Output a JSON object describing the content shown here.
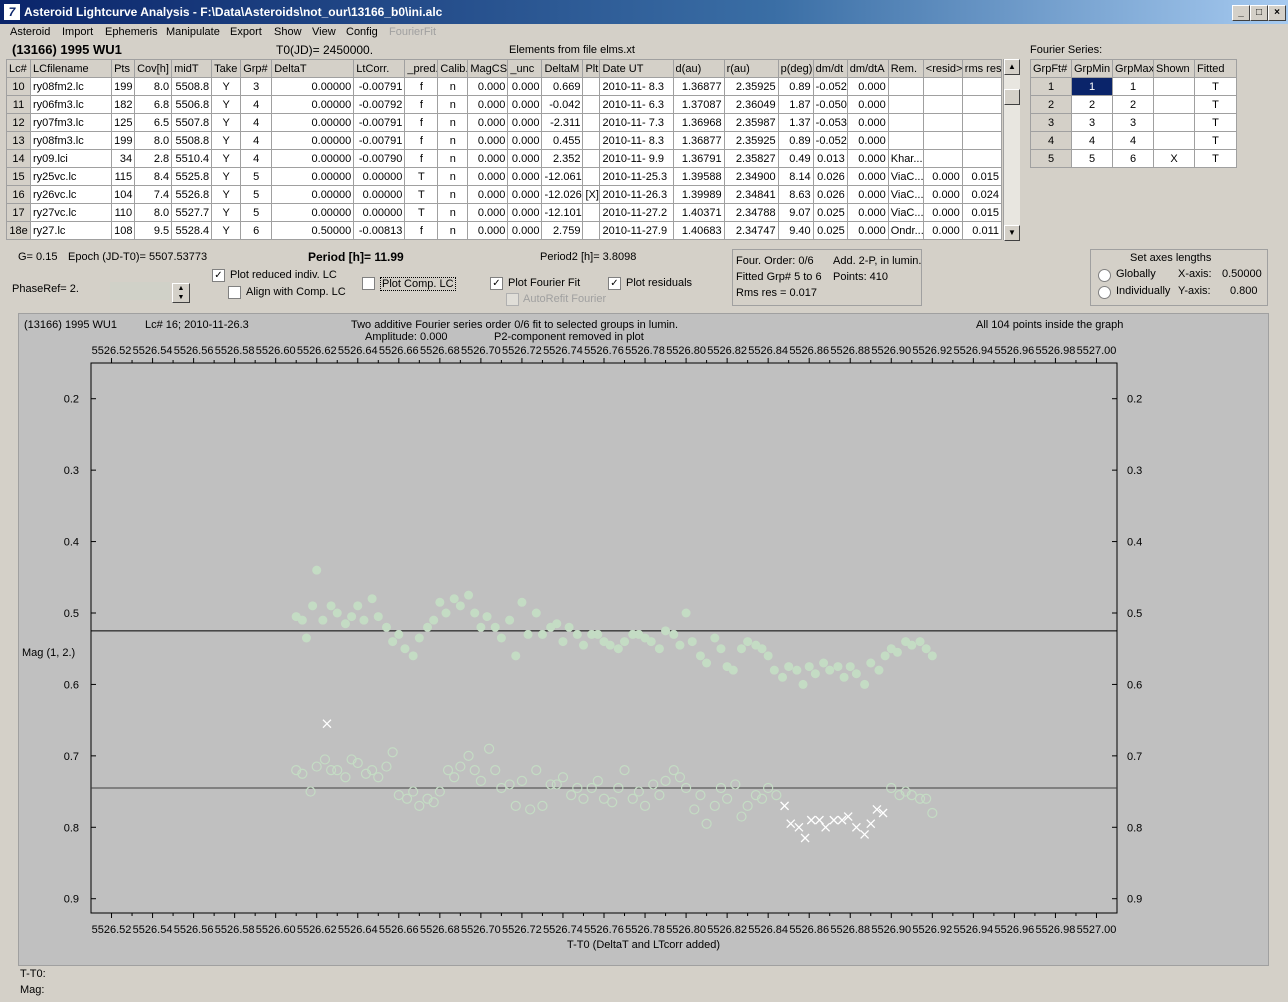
{
  "window": {
    "title": "Asteroid Lightcurve Analysis - F:\\Data\\Asteroids\\not_our\\13166_b0\\ini.alc",
    "icon": "app-icon"
  },
  "menu": [
    "Asteroid",
    "Import",
    "Ephemeris",
    "Manipulate",
    "Export",
    "Show",
    "View",
    "Config",
    "FourierFit"
  ],
  "header": {
    "asteroid": "(13166) 1995 WU1",
    "t0": "T0(JD)= 2450000.",
    "elements": "Elements from file elms.xt",
    "fourier_title": "Fourier Series:"
  },
  "lc_table": {
    "columns": [
      "Lc#",
      "LCfilename",
      "Pts",
      "Cov[h]",
      "midT",
      "Take",
      "Grp#",
      "DeltaT",
      "LtCorr.",
      "_pred.",
      "Calib.",
      "MagCS",
      "_unc",
      "DeltaM",
      "Plt",
      "Date UT",
      "d(au)",
      "r(au)",
      "p(deg)",
      "dm/dt",
      "dm/dtA",
      "Rem.",
      "<resid>",
      "rms res"
    ],
    "rows": [
      [
        "10",
        "ry08fm2.lc",
        "199",
        "8.0",
        "5508.8",
        "Y",
        "3",
        "0.00000",
        "-0.00791",
        "f",
        "n",
        "0.000",
        "0.000",
        "0.669",
        "",
        "2010-11- 8.3",
        "1.36877",
        "2.35925",
        "0.89",
        "-0.052",
        "0.000",
        "",
        "",
        ""
      ],
      [
        "11",
        "ry06fm3.lc",
        "182",
        "6.8",
        "5506.8",
        "Y",
        "4",
        "0.00000",
        "-0.00792",
        "f",
        "n",
        "0.000",
        "0.000",
        "-0.042",
        "",
        "2010-11- 6.3",
        "1.37087",
        "2.36049",
        "1.87",
        "-0.050",
        "0.000",
        "",
        "",
        ""
      ],
      [
        "12",
        "ry07fm3.lc",
        "125",
        "6.5",
        "5507.8",
        "Y",
        "4",
        "0.00000",
        "-0.00791",
        "f",
        "n",
        "0.000",
        "0.000",
        "-2.311",
        "",
        "2010-11- 7.3",
        "1.36968",
        "2.35987",
        "1.37",
        "-0.053",
        "0.000",
        "",
        "",
        ""
      ],
      [
        "13",
        "ry08fm3.lc",
        "199",
        "8.0",
        "5508.8",
        "Y",
        "4",
        "0.00000",
        "-0.00791",
        "f",
        "n",
        "0.000",
        "0.000",
        "0.455",
        "",
        "2010-11- 8.3",
        "1.36877",
        "2.35925",
        "0.89",
        "-0.052",
        "0.000",
        "",
        "",
        ""
      ],
      [
        "14",
        "ry09.lci",
        "34",
        "2.8",
        "5510.4",
        "Y",
        "4",
        "0.00000",
        "-0.00790",
        "f",
        "n",
        "0.000",
        "0.000",
        "2.352",
        "",
        "2010-11- 9.9",
        "1.36791",
        "2.35827",
        "0.49",
        "0.013",
        "0.000",
        "Khar...",
        "",
        ""
      ],
      [
        "15",
        "ry25vc.lc",
        "115",
        "8.4",
        "5525.8",
        "Y",
        "5",
        "0.00000",
        "0.00000",
        "T",
        "n",
        "0.000",
        "0.000",
        "-12.061",
        "",
        "2010-11-25.3",
        "1.39588",
        "2.34900",
        "8.14",
        "0.026",
        "0.000",
        "ViaC...",
        "0.000",
        "0.015"
      ],
      [
        "16",
        "ry26vc.lc",
        "104",
        "7.4",
        "5526.8",
        "Y",
        "5",
        "0.00000",
        "0.00000",
        "T",
        "n",
        "0.000",
        "0.000",
        "-12.026",
        "[X]",
        "2010-11-26.3",
        "1.39989",
        "2.34841",
        "8.63",
        "0.026",
        "0.000",
        "ViaC...",
        "0.000",
        "0.024"
      ],
      [
        "17",
        "ry27vc.lc",
        "110",
        "8.0",
        "5527.7",
        "Y",
        "5",
        "0.00000",
        "0.00000",
        "T",
        "n",
        "0.000",
        "0.000",
        "-12.101",
        "",
        "2010-11-27.2",
        "1.40371",
        "2.34788",
        "9.07",
        "0.025",
        "0.000",
        "ViaC...",
        "0.000",
        "0.015"
      ],
      [
        "18e",
        "ry27.lc",
        "108",
        "9.5",
        "5528.4",
        "Y",
        "6",
        "0.50000",
        "-0.00813",
        "f",
        "n",
        "0.000",
        "0.000",
        "2.759",
        "",
        "2010-11-27.9",
        "1.40683",
        "2.34747",
        "9.40",
        "0.025",
        "0.000",
        "Ondr...",
        "0.000",
        "0.011"
      ]
    ]
  },
  "fourier_table": {
    "columns": [
      "GrpFt#",
      "GrpMin",
      "GrpMax",
      "Shown",
      "Fitted"
    ],
    "rows": [
      [
        "1",
        "1",
        "1",
        "",
        "T"
      ],
      [
        "2",
        "2",
        "2",
        "",
        "T"
      ],
      [
        "3",
        "3",
        "3",
        "",
        "T"
      ],
      [
        "4",
        "4",
        "4",
        "",
        "T"
      ],
      [
        "5",
        "5",
        "6",
        "X",
        "T"
      ]
    ]
  },
  "params": {
    "g": "G= 0.15",
    "epoch": "Epoch (JD-T0)= 5507.53773",
    "period": "Period [h]= 11.99",
    "period2": "Period2 [h]= 3.8098",
    "phaseref": "PhaseRef= 2."
  },
  "checks": {
    "plot_reduced": {
      "label": "Plot reduced indiv. LC",
      "checked": "✓"
    },
    "align_comp": {
      "label": "Align with Comp. LC",
      "checked": ""
    },
    "plot_comp": {
      "label": "Plot Comp. LC",
      "checked": ""
    },
    "plot_fourier": {
      "label": "Plot Fourier Fit",
      "checked": "✓"
    },
    "autorefit": {
      "label": "AutoRefit Fourier",
      "checked": ""
    },
    "plot_resid": {
      "label": "Plot residuals",
      "checked": "✓"
    }
  },
  "fitinfo": {
    "line1a": "Four. Order:  0/6",
    "line1b": "Add. 2-P, in lumin.",
    "line2a": "Fitted Grp# 5 to 6",
    "line2b": "Points: 410",
    "line3": "Rms res     = 0.017"
  },
  "axes_box": {
    "title": "Set axes lengths",
    "globally": "Globally",
    "individually": "Individually",
    "xaxis": "X-axis:",
    "xval": "0.50000",
    "yaxis": "Y-axis:",
    "yval": "0.800"
  },
  "plot_header": {
    "obj": "(13166) 1995 WU1",
    "lc": "Lc# 16; 2010-11-26.3",
    "desc1": "Two additive Fourier series order 0/6 fit to selected groups in lumin.",
    "desc2": "Amplitude: 0.000",
    "desc3": "P2-component removed in plot",
    "inside": "All 104 points inside the graph"
  },
  "plot_status": {
    "t": "T-T0:",
    "m": "Mag:"
  },
  "chart_data": {
    "type": "scatter",
    "xlabel": "T-T0 (DeltaT and LTcorr added)",
    "ylabel": "Mag\n(1, 2.)",
    "xlim": [
      5526.51,
      5527.01
    ],
    "ylim": [
      0.15,
      0.92
    ],
    "x_ticks": [
      "5526.52",
      "5526.54",
      "5526.56",
      "5526.58",
      "5526.60",
      "5526.62",
      "5526.64",
      "5526.66",
      "5526.68",
      "5526.70",
      "5526.72",
      "5526.74",
      "5526.76",
      "5526.78",
      "5526.80",
      "5526.82",
      "5526.84",
      "5526.86",
      "5526.88",
      "5526.90",
      "5526.92",
      "5526.94",
      "5526.96",
      "5526.98",
      "5527.00"
    ],
    "y_ticks": [
      0.2,
      0.3,
      0.4,
      0.5,
      0.6,
      0.7,
      0.8,
      0.9
    ],
    "fit_mag": 0.525,
    "resid_mag": 0.745,
    "colors": {
      "data": "#c4dcc4",
      "fit": "#000000",
      "resid": "#404040",
      "cross": "#ffffff"
    },
    "series": [
      {
        "name": "data",
        "x": [
          5526.61,
          5526.613,
          5526.615,
          5526.618,
          5526.62,
          5526.623,
          5526.627,
          5526.63,
          5526.634,
          5526.637,
          5526.64,
          5526.643,
          5526.647,
          5526.65,
          5526.654,
          5526.657,
          5526.66,
          5526.663,
          5526.667,
          5526.67,
          5526.674,
          5526.677,
          5526.68,
          5526.683,
          5526.687,
          5526.69,
          5526.694,
          5526.697,
          5526.7,
          5526.703,
          5526.707,
          5526.71,
          5526.714,
          5526.717,
          5526.72,
          5526.723,
          5526.727,
          5526.73,
          5526.734,
          5526.737,
          5526.74,
          5526.743,
          5526.747,
          5526.75,
          5526.754,
          5526.757,
          5526.76,
          5526.763,
          5526.767,
          5526.77,
          5526.774,
          5526.777,
          5526.78,
          5526.783,
          5526.787,
          5526.79,
          5526.794,
          5526.797,
          5526.8,
          5526.803,
          5526.807,
          5526.81,
          5526.814,
          5526.817,
          5526.82,
          5526.823,
          5526.827,
          5526.83,
          5526.834,
          5526.837,
          5526.84,
          5526.843,
          5526.847,
          5526.85,
          5526.854,
          5526.857,
          5526.86,
          5526.863,
          5526.867,
          5526.87,
          5526.874,
          5526.877,
          5526.88,
          5526.883,
          5526.887,
          5526.89,
          5526.894,
          5526.897,
          5526.9,
          5526.903,
          5526.907,
          5526.91,
          5526.914,
          5526.917,
          5526.92
        ],
        "y": [
          0.505,
          0.51,
          0.535,
          0.49,
          0.44,
          0.51,
          0.49,
          0.5,
          0.515,
          0.505,
          0.49,
          0.51,
          0.48,
          0.505,
          0.52,
          0.54,
          0.53,
          0.55,
          0.56,
          0.535,
          0.52,
          0.51,
          0.485,
          0.5,
          0.48,
          0.49,
          0.475,
          0.5,
          0.52,
          0.505,
          0.52,
          0.535,
          0.51,
          0.56,
          0.485,
          0.53,
          0.5,
          0.53,
          0.52,
          0.515,
          0.54,
          0.52,
          0.53,
          0.545,
          0.53,
          0.53,
          0.54,
          0.545,
          0.55,
          0.54,
          0.53,
          0.53,
          0.535,
          0.54,
          0.55,
          0.525,
          0.53,
          0.545,
          0.5,
          0.54,
          0.56,
          0.57,
          0.535,
          0.55,
          0.575,
          0.58,
          0.55,
          0.54,
          0.545,
          0.55,
          0.56,
          0.58,
          0.59,
          0.575,
          0.58,
          0.6,
          0.575,
          0.585,
          0.57,
          0.58,
          0.575,
          0.59,
          0.575,
          0.585,
          0.6,
          0.57,
          0.58,
          0.56,
          0.55,
          0.555,
          0.54,
          0.545,
          0.54,
          0.55,
          0.56
        ]
      },
      {
        "name": "residuals",
        "x": [
          5526.61,
          5526.613,
          5526.617,
          5526.62,
          5526.624,
          5526.627,
          5526.63,
          5526.634,
          5526.637,
          5526.64,
          5526.644,
          5526.647,
          5526.65,
          5526.654,
          5526.657,
          5526.66,
          5526.664,
          5526.667,
          5526.67,
          5526.674,
          5526.677,
          5526.68,
          5526.684,
          5526.687,
          5526.69,
          5526.694,
          5526.697,
          5526.7,
          5526.704,
          5526.707,
          5526.71,
          5526.714,
          5526.717,
          5526.72,
          5526.724,
          5526.727,
          5526.73,
          5526.734,
          5526.737,
          5526.74,
          5526.744,
          5526.747,
          5526.75,
          5526.754,
          5526.757,
          5526.76,
          5526.764,
          5526.767,
          5526.77,
          5526.774,
          5526.777,
          5526.78,
          5526.784,
          5526.787,
          5526.79,
          5526.794,
          5526.797,
          5526.8,
          5526.804,
          5526.807,
          5526.81,
          5526.814,
          5526.817,
          5526.82,
          5526.824,
          5526.827,
          5526.83,
          5526.834,
          5526.837,
          5526.84,
          5526.844,
          5526.9,
          5526.904,
          5526.907,
          5526.91,
          5526.914,
          5526.917,
          5526.92
        ],
        "y": [
          0.72,
          0.725,
          0.75,
          0.715,
          0.705,
          0.72,
          0.72,
          0.73,
          0.705,
          0.71,
          0.725,
          0.72,
          0.73,
          0.715,
          0.695,
          0.755,
          0.76,
          0.75,
          0.77,
          0.76,
          0.765,
          0.75,
          0.72,
          0.73,
          0.715,
          0.7,
          0.72,
          0.735,
          0.69,
          0.72,
          0.745,
          0.74,
          0.77,
          0.735,
          0.775,
          0.72,
          0.77,
          0.74,
          0.74,
          0.73,
          0.755,
          0.745,
          0.76,
          0.745,
          0.735,
          0.76,
          0.765,
          0.745,
          0.72,
          0.76,
          0.75,
          0.77,
          0.74,
          0.755,
          0.735,
          0.72,
          0.73,
          0.745,
          0.775,
          0.755,
          0.795,
          0.77,
          0.745,
          0.76,
          0.74,
          0.785,
          0.77,
          0.755,
          0.76,
          0.745,
          0.755,
          0.745,
          0.755,
          0.75,
          0.755,
          0.76,
          0.76,
          0.78
        ]
      },
      {
        "name": "rejected",
        "x": [
          5526.625,
          5526.848,
          5526.851,
          5526.855,
          5526.858,
          5526.861,
          5526.865,
          5526.868,
          5526.872,
          5526.876,
          5526.879,
          5526.883,
          5526.887,
          5526.89,
          5526.893,
          5526.896
        ],
        "y": [
          0.655,
          0.77,
          0.795,
          0.8,
          0.815,
          0.79,
          0.79,
          0.8,
          0.79,
          0.79,
          0.785,
          0.8,
          0.81,
          0.795,
          0.775,
          0.78
        ]
      }
    ]
  }
}
